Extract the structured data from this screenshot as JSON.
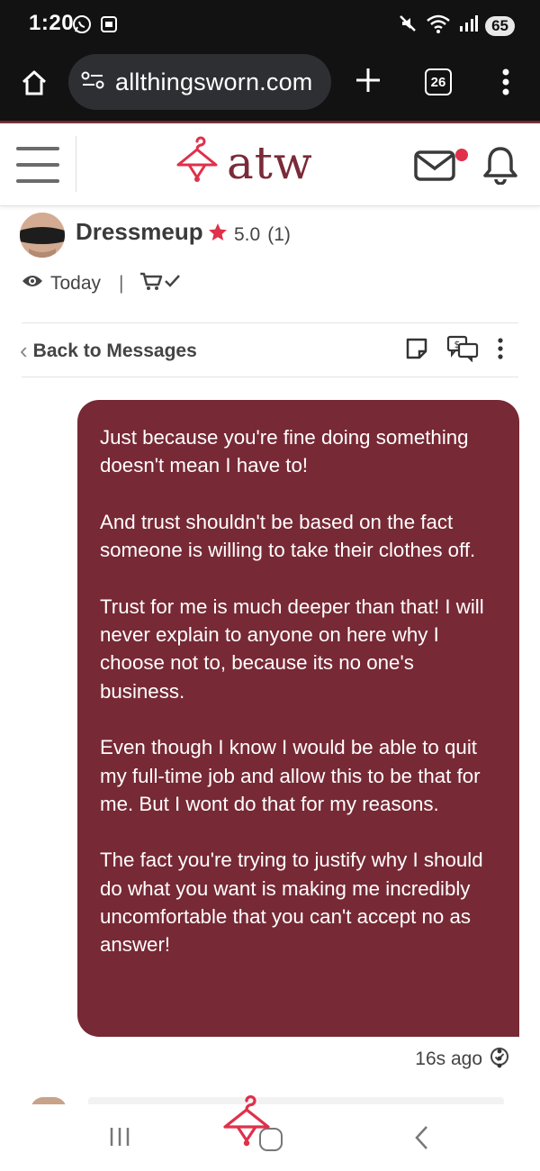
{
  "status_bar": {
    "time": "1:20",
    "battery": "65"
  },
  "browser": {
    "url": "allthingsworn.com",
    "tab_count": "26"
  },
  "site": {
    "logo_text": "atw",
    "accent_color": "#772935",
    "notification_dot_color": "#e0304a"
  },
  "profile": {
    "name": "Dressmeup",
    "rating": "5.0",
    "rating_count": "(1)",
    "last_seen": "Today"
  },
  "thread": {
    "back_label": "Back to Messages"
  },
  "message": {
    "paragraphs": [
      "Just because you're fine doing something doesn't mean I have to!",
      "And trust shouldn't be based on the fact someone is willing to take their clothes off.",
      "Trust for me is much deeper than that! I will never explain to anyone on here why I choose not to, because its no one's business.",
      "Even though I know I would be able to quit my full-time job and allow this to be that for me. But I wont do that for my reasons.",
      "The fact you're trying to justify why I should do what you want is making me incredibly uncomfortable that you can't accept no as answer!"
    ],
    "timestamp": "16s ago"
  },
  "icons": {
    "status_left": [
      "whatsapp-icon",
      "screenshot-icon"
    ],
    "status_right": [
      "mute-icon",
      "wifi-icon",
      "signal-icon",
      "battery-icon"
    ],
    "browser": [
      "home-icon",
      "site-info-icon",
      "new-tab-icon",
      "tab-switcher-icon",
      "browser-menu-icon"
    ],
    "header": [
      "hamburger-menu-icon",
      "hanger-logo-icon",
      "mail-icon",
      "bell-icon"
    ],
    "thread": [
      "eye-icon",
      "cart-check-icon",
      "note-icon",
      "price-offer-icon",
      "more-options-icon"
    ],
    "nav": [
      "recents-icon",
      "home-nav-icon",
      "back-nav-icon"
    ]
  }
}
